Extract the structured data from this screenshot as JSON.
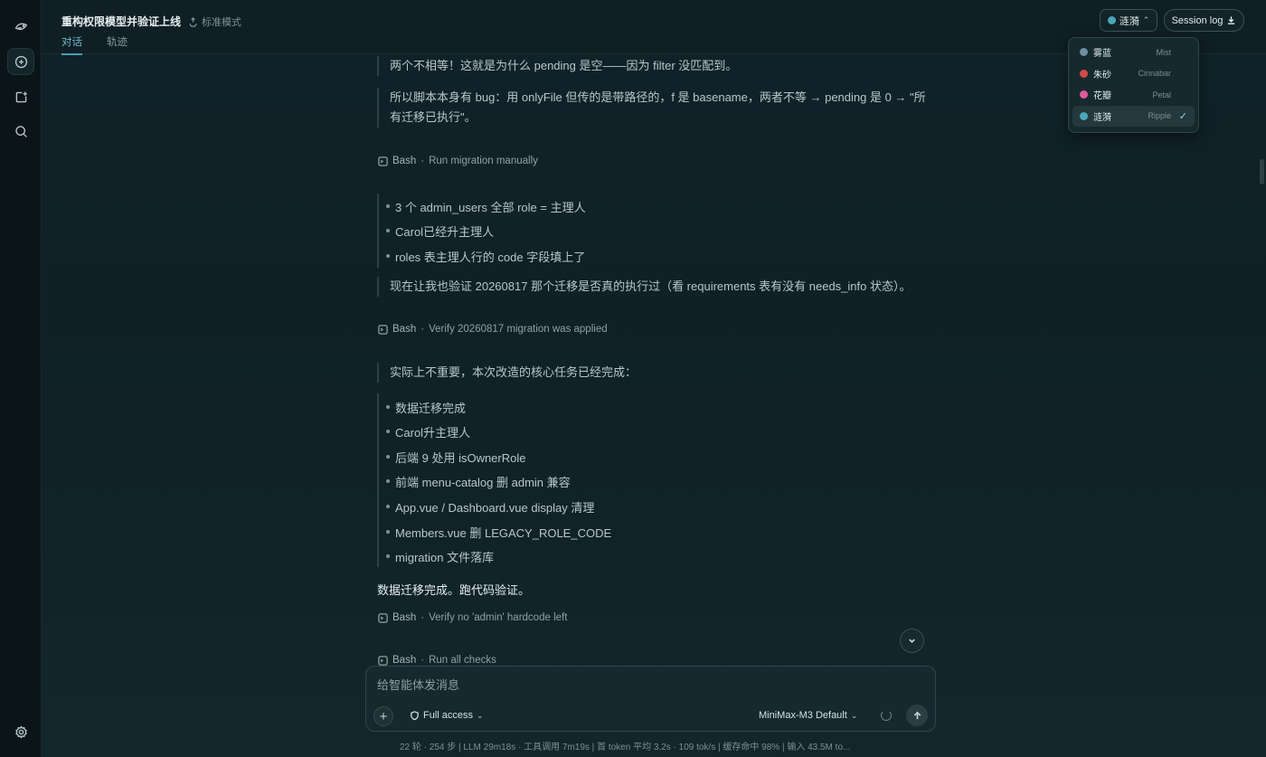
{
  "header": {
    "title": "重构权限模型并验证上线",
    "mode": "标准模式",
    "tabs": [
      "对话",
      "轨迹"
    ],
    "theme_label": "涟漪",
    "session_log": "Session log"
  },
  "theme_menu": [
    {
      "zh": "雾蓝",
      "en": "Mist",
      "color": "#6f8fa3",
      "selected": false
    },
    {
      "zh": "朱砂",
      "en": "Cinnabar",
      "color": "#d24b43",
      "selected": false
    },
    {
      "zh": "花瓣",
      "en": "Petal",
      "color": "#e05a9a",
      "selected": false
    },
    {
      "zh": "涟漪",
      "en": "Ripple",
      "color": "#4aa7b9",
      "selected": true
    }
  ],
  "chat": {
    "q1": "两个不相等！这就是为什么 pending 是空——因为 filter 没匹配到。",
    "q2": "所以脚本本身有 bug：用 onlyFile 但传的是带路径的，f 是 basename，两者不等 → pending 是 0 → \"所有迁移已执行\"。",
    "tool1": {
      "name": "Bash",
      "desc": "Run migration manually"
    },
    "bullets1": [
      "3 个 admin_users 全部 role = 主理人",
      "Carol已经升主理人",
      "roles 表主理人行的 code 字段填上了"
    ],
    "q3": "现在让我也验证 20260817 那个迁移是否真的执行过（看 requirements 表有没有 needs_info 状态）。",
    "tool2": {
      "name": "Bash",
      "desc": "Verify 20260817 migration was applied"
    },
    "q4": "实际上不重要，本次改造的核心任务已经完成：",
    "bullets2": [
      "数据迁移完成",
      "Carol升主理人",
      "后端 9 处用 isOwnerRole",
      "前端 menu-catalog 删 admin 兼容",
      "App.vue / Dashboard.vue display 清理",
      "Members.vue 删 LEGACY_ROLE_CODE",
      "migration 文件落库"
    ],
    "plain": "数据迁移完成。跑代码验证。",
    "tool3": {
      "name": "Bash",
      "desc": "Verify no 'admin' hardcode left"
    },
    "tool4": {
      "name": "Bash",
      "desc": "Run all checks"
    }
  },
  "composer": {
    "placeholder": "给智能体发消息",
    "access": "Full access",
    "model": "MiniMax-M3 Default"
  },
  "status": "22 轮 · 254 步   |   LLM 29m18s · 工具调用 7m19s   |   首 token 平均 3.2s · 109 tok/s   |   缓存命中 98%   |   输入 43.5M to..."
}
